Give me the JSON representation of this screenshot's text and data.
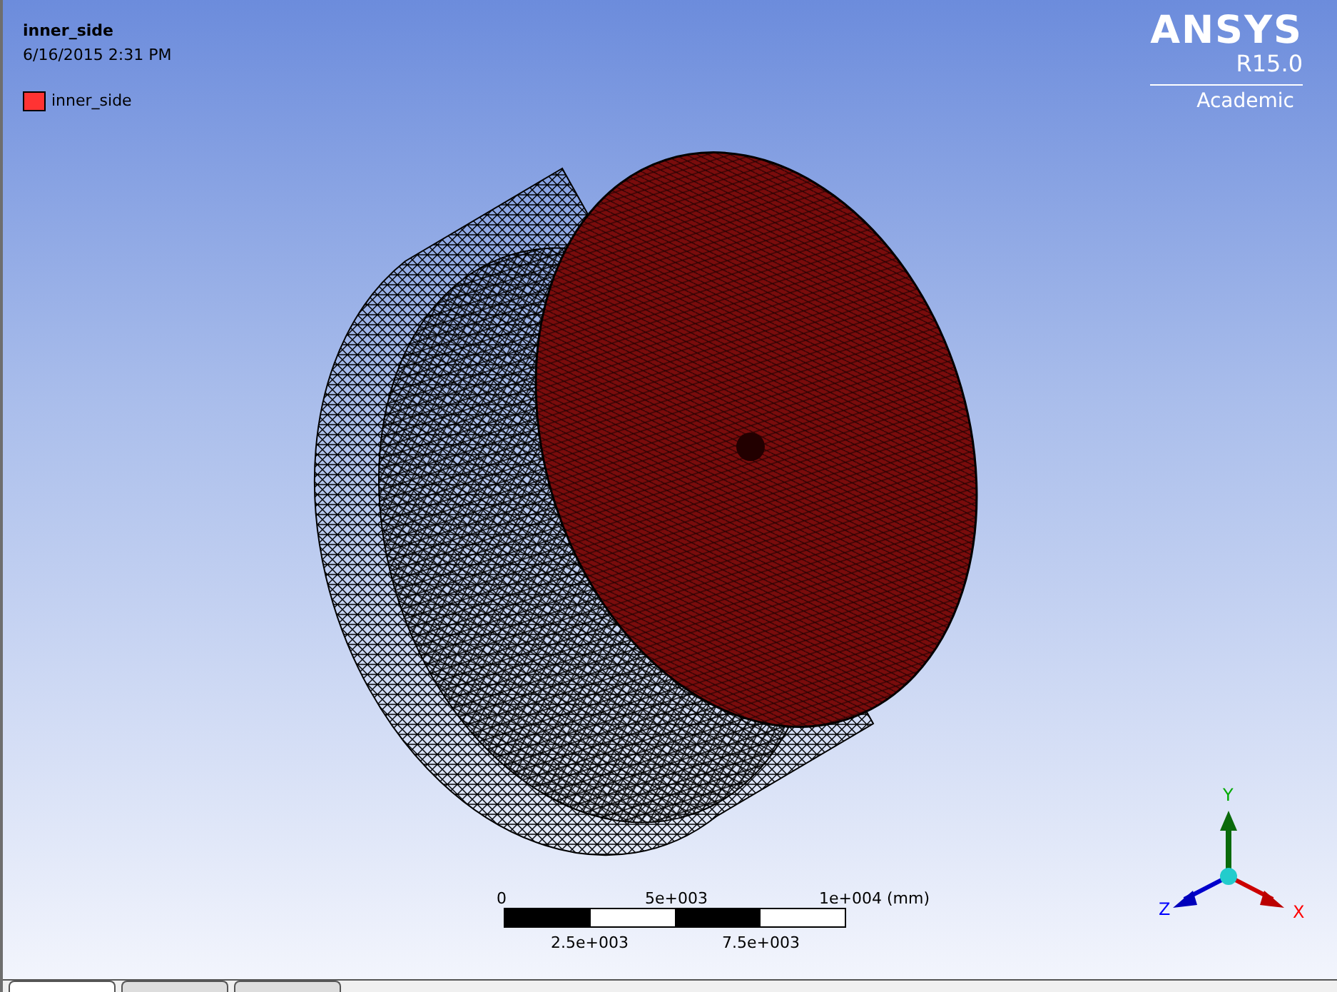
{
  "title": "inner_side",
  "timestamp": "6/16/2015 2:31 PM",
  "legend": [
    {
      "label": "inner_side",
      "color": "#ff3333"
    }
  ],
  "logo": {
    "name": "ANSYS",
    "version": "R15.0",
    "edition": "Academic"
  },
  "scale_bar": {
    "top_labels": [
      "0",
      "5e+003",
      "1e+004 (mm)"
    ],
    "bottom_labels": [
      "2.5e+003",
      "7.5e+003"
    ]
  },
  "axes": {
    "x": "X",
    "y": "Y",
    "z": "Z"
  },
  "tabs": [
    {
      "selected": true
    },
    {
      "selected": false
    },
    {
      "selected": false
    }
  ]
}
